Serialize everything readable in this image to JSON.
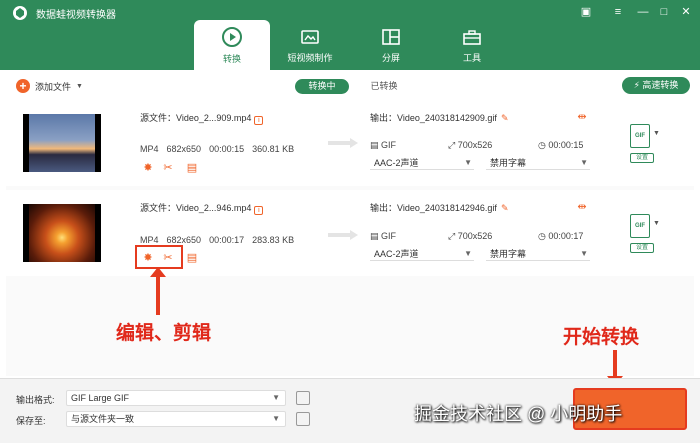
{
  "app": {
    "title": "数据蛙视频转换器"
  },
  "tabs": [
    {
      "label": "转换",
      "icon": "convert-icon",
      "active": true
    },
    {
      "label": "短视频制作",
      "icon": "short-video-icon",
      "active": false
    },
    {
      "label": "分屏",
      "icon": "split-screen-icon",
      "active": false
    },
    {
      "label": "工具",
      "icon": "toolbox-icon",
      "active": false
    }
  ],
  "toolbar": {
    "add_file": "添加文件",
    "converting": "转换中",
    "converted": "已转换",
    "fast_convert": "高速转换"
  },
  "files": [
    {
      "source": "源文件：Video_2...909.mp4",
      "format": "MP4",
      "resolution": "682x650",
      "duration": "00:00:15",
      "size": "360.81 KB",
      "output": "输出：Video_240318142909.gif",
      "out_format": "GIF",
      "out_resolution": "700x526",
      "out_duration": "00:00:15",
      "audio": "AAC-2声道",
      "subtitle": "禁用字幕",
      "settings": "设置"
    },
    {
      "source": "源文件：Video_2...946.mp4",
      "format": "MP4",
      "resolution": "682x650",
      "duration": "00:00:17",
      "size": "283.83 KB",
      "output": "输出：Video_240318142946.gif",
      "out_format": "GIF",
      "out_resolution": "700x526",
      "out_duration": "00:00:17",
      "audio": "AAC-2声道",
      "subtitle": "禁用字幕",
      "settings": "设置"
    }
  ],
  "annotations": {
    "edit_cut": "编辑、剪辑",
    "start": "开始转换"
  },
  "bottom": {
    "output_format_label": "输出格式:",
    "output_format_value": "GIF Large GIF",
    "save_to_label": "保存至:",
    "save_to_value": "与源文件夹一致"
  },
  "watermark": "掘金技术社区 @ 小明助手",
  "colors": {
    "brand": "#2f8a5a",
    "accent": "#f0642a",
    "annotation": "#e0281a"
  }
}
